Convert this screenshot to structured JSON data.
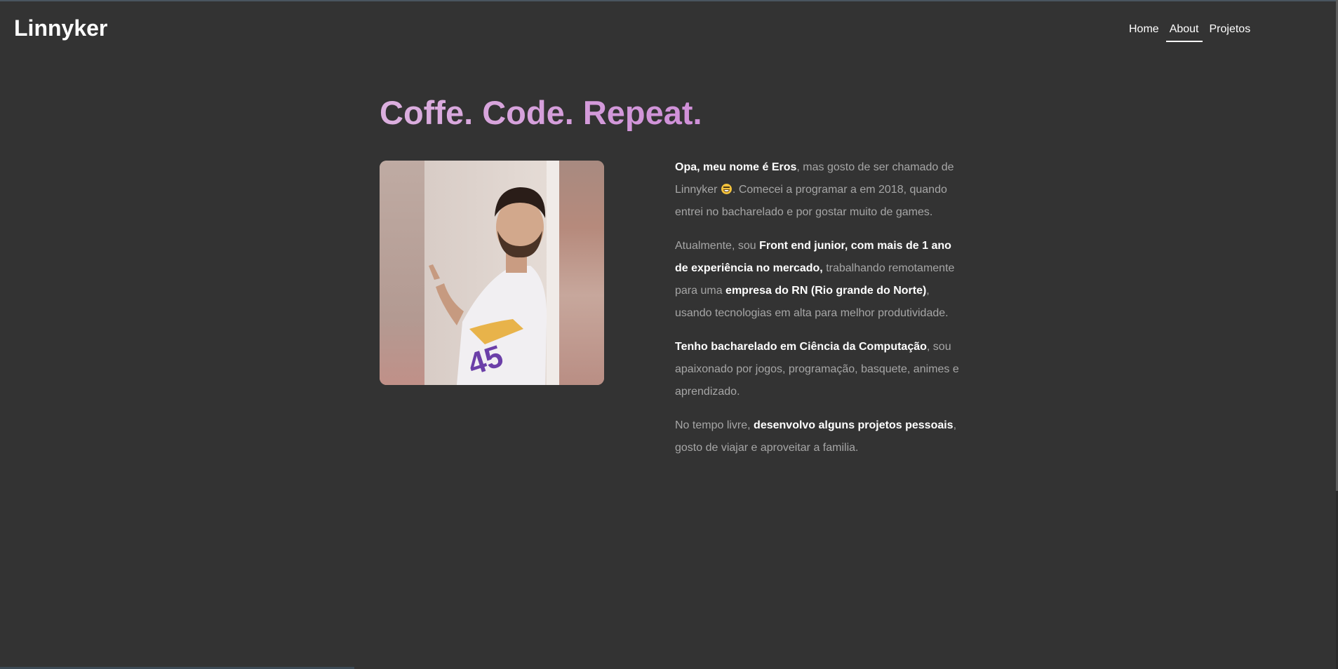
{
  "header": {
    "logo": "Linnyker",
    "nav": [
      {
        "label": "Home",
        "active": false
      },
      {
        "label": "About",
        "active": true
      },
      {
        "label": "Projetos",
        "active": false
      }
    ]
  },
  "main": {
    "title": "Coffe. Code. Repeat.",
    "title_color": "#d9a6e0",
    "photo_icon": "profile-photo",
    "bio": {
      "p1": {
        "bold_1": "Opa, meu nome é Eros",
        "text_1": ", mas gosto de ser chamado de Linnyker ",
        "emoji": "grinning-face-icon",
        "text_2": ". Comecei a programar a em 2018, quando entrei no bacharelado e por gostar muito de games."
      },
      "p2": {
        "text_1": "Atualmente, sou ",
        "bold_1": "Front end junior, com mais de 1 ano de experiência no mercado,",
        "text_2": " trabalhando remotamente para uma ",
        "bold_2": "empresa do RN (Rio grande do Norte)",
        "text_3": ", usando tecnologias em alta para melhor produtividade."
      },
      "p3": {
        "bold_1": "Tenho bacharelado em Ciência da Computação",
        "text_1": ", sou apaixonado por jogos, programação, basquete, animes e aprendizado."
      },
      "p4": {
        "text_1": "No tempo livre, ",
        "bold_1": "desenvolvo alguns projetos pessoais",
        "text_2": ", gosto de viajar e aproveitar a familia."
      }
    }
  },
  "colors": {
    "background": "#333333",
    "text_muted": "#a6a6a6",
    "text_strong": "#ffffff",
    "accent": "#d9a6e0"
  }
}
